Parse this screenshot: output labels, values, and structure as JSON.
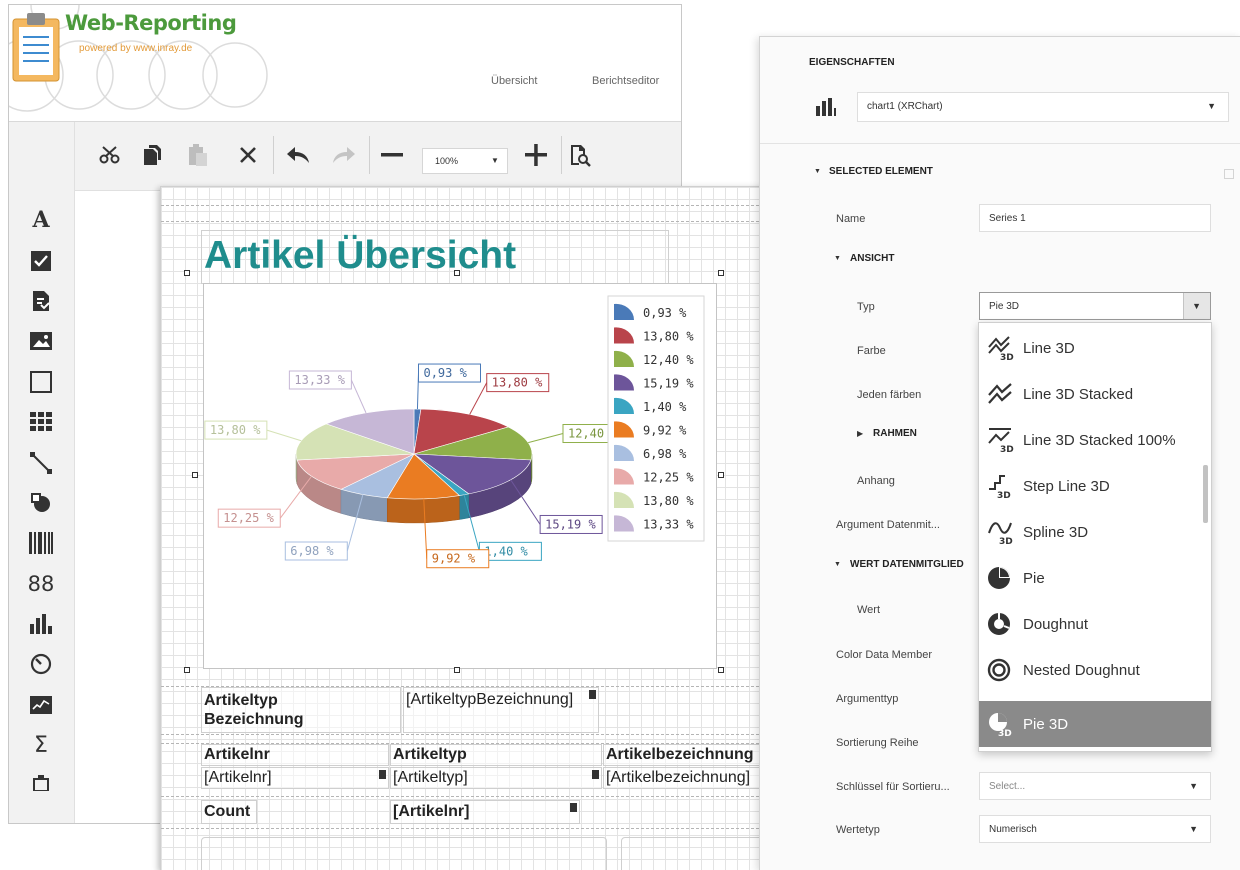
{
  "logo": {
    "title": "Web-Reporting",
    "subtitle": "powered by www.inray.de"
  },
  "nav": {
    "overview": "Übersicht",
    "report_editor": "Berichtseditor"
  },
  "toolbar": {
    "zoom": "100%"
  },
  "left_rail": {
    "items": [
      "text-icon",
      "checkbox-icon",
      "rich-text-icon",
      "picture-icon",
      "panel-icon",
      "table-icon",
      "line-icon",
      "shape-icon",
      "barcode-icon",
      "zip-code-icon",
      "chart-icon",
      "gauge-icon",
      "sparkline-icon",
      "sum-icon",
      "page-info-icon"
    ],
    "zip_glyph": "88",
    "sum_glyph": "Σ"
  },
  "report": {
    "title": "Artikel Übersicht",
    "group_header_label": "Artikeltyp\nBezeichnung",
    "group_header_field": "[ArtikeltypBezeichnung]",
    "columns": [
      "Artikelnr",
      "Artikeltyp",
      "Artikelbezeichnung"
    ],
    "detail_fields": [
      "[Artikelnr]",
      "[Artikeltyp]",
      "[Artikelbezeichnung]"
    ],
    "footer_label": "Count",
    "footer_field": "[Artikelnr]"
  },
  "chart_data": {
    "type": "pie",
    "labels": [
      "0,93 %",
      "13,80 %",
      "12,40 %",
      "15,19 %",
      "1,40 %",
      "9,92 %",
      "6,98 %",
      "12,25 %",
      "13,80 %",
      "13,33 %"
    ],
    "values": [
      0.93,
      13.8,
      12.4,
      15.19,
      1.4,
      9.92,
      6.98,
      12.25,
      13.8,
      13.33
    ],
    "colors": [
      "#4a7ab8",
      "#b9444b",
      "#8fb04a",
      "#6d559a",
      "#3aa5c2",
      "#ea7c22",
      "#a9bfe0",
      "#e8aaa9",
      "#d5e2b5",
      "#c6b7d6"
    ],
    "legend_position": "right"
  },
  "properties": {
    "heading": "EIGENSCHAFTEN",
    "component": "chart1 (XRChart)",
    "selected_element": "SELECTED ELEMENT",
    "name_label": "Name",
    "name_value": "Series 1",
    "ansicht": "ANSICHT",
    "typ_label": "Typ",
    "typ_value": "Pie 3D",
    "farbe": "Farbe",
    "jeden_faerben": "Jeden färben",
    "rahmen": "RAHMEN",
    "anhang": "Anhang",
    "argument_datenmit": "Argument Datenmit...",
    "wert_datenmitglied": "WERT DATENMITGLIED",
    "wert": "Wert",
    "color_data_member": "Color Data Member",
    "argumenttyp": "Argumenttyp",
    "sortierung_reihe": "Sortierung Reihe",
    "schluessel_label": "Schlüssel für Sortieru...",
    "schluessel_value": "Select...",
    "wertetyp_label": "Wertetyp",
    "wertetyp_value": "Numerisch"
  },
  "type_dropdown": {
    "items": [
      "Line 3D",
      "Line 3D Stacked",
      "Line 3D Stacked 100%",
      "Step Line 3D",
      "Spline 3D",
      "Pie",
      "Doughnut",
      "Nested Doughnut",
      "Pie 3D"
    ],
    "selected": "Pie 3D",
    "badge_3d": "3D"
  }
}
